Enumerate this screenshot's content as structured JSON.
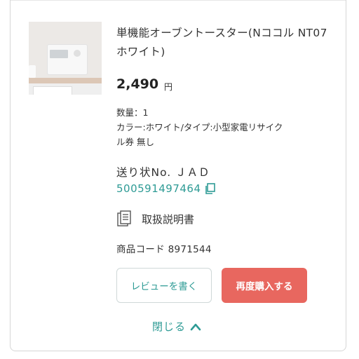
{
  "product": {
    "title": "単機能オーブントースター(Nココル NT07 ホワイト)",
    "price": "2,490",
    "currency": "円",
    "quantity_line": "数量：1",
    "option_line_1": "カラー:ホワイト/タイプ:小型家電リサイク",
    "option_line_2": "ル券 無し",
    "image_icon": "toaster-photo"
  },
  "shipping": {
    "label": "送り状No. ＪＡＤ",
    "tracking_number": "500591497464",
    "copy_icon": "copy-icon"
  },
  "manual": {
    "label": "取扱説明書",
    "icon": "document-icon"
  },
  "product_code": "商品コード 8971544",
  "actions": {
    "review_label": "レビューを書く",
    "rebuy_label": "再度購入する"
  },
  "close": {
    "label": "閉じる",
    "icon": "chevron-up-icon"
  },
  "colors": {
    "accent": "#2e9b95",
    "rebuy_button": "#e8675f"
  }
}
